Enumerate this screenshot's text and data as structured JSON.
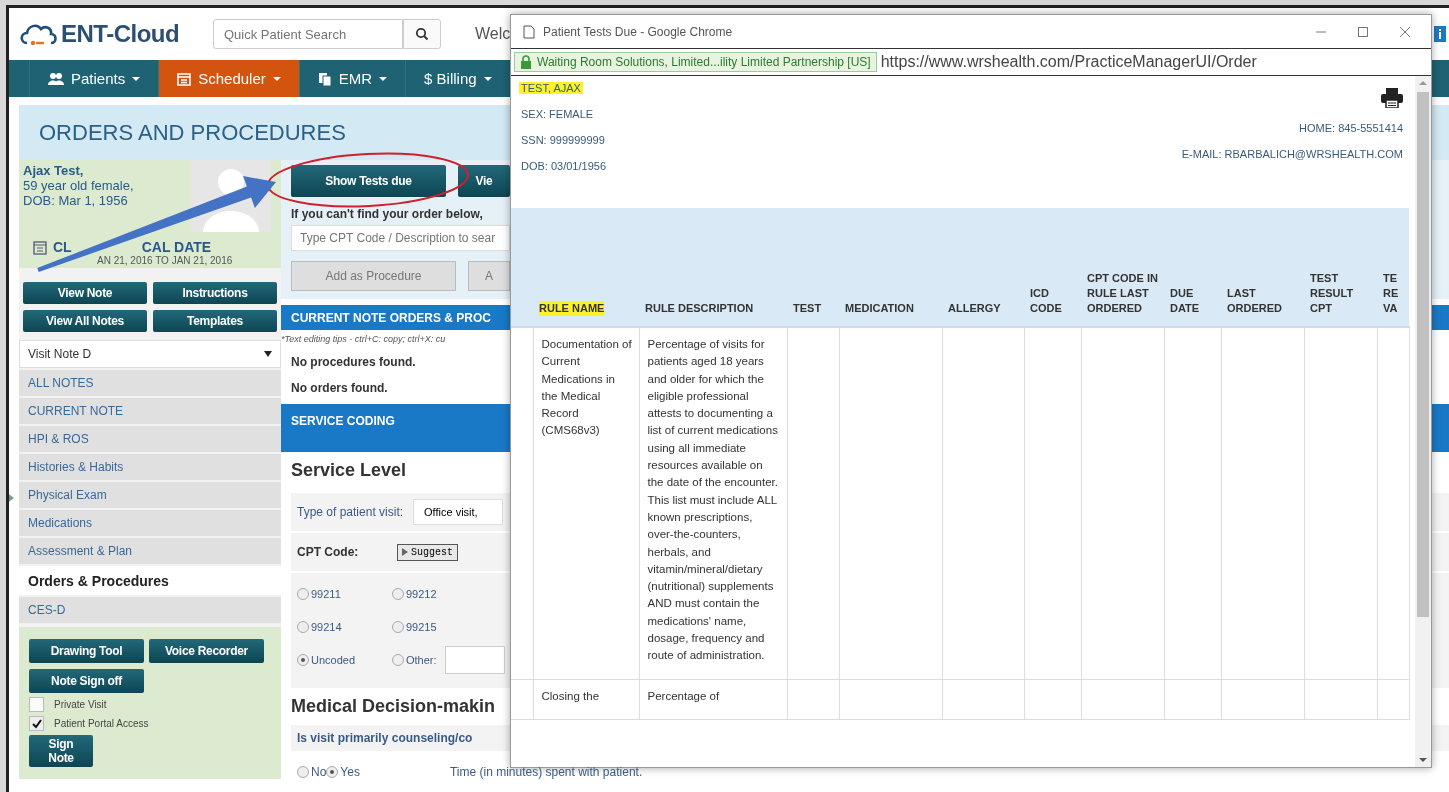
{
  "app": {
    "logo": "ENT-Cloud",
    "search": {
      "placeholder": "Quick Patient Search"
    },
    "welcome": "Welc"
  },
  "nav": [
    {
      "label": "Patients",
      "selected": false
    },
    {
      "label": "Scheduler",
      "selected": true
    },
    {
      "label": "EMR",
      "selected": false
    },
    {
      "label": "$ Billing",
      "selected": false
    }
  ],
  "page_title": "ORDERS AND PROCEDURES",
  "patient": {
    "name": "Ajax Test,",
    "age": "59 year old female,",
    "dob": "DOB: Mar 1, 1956",
    "clinical_date_label": [
      "CL",
      "CAL DATE"
    ],
    "clinical_date": "AN 21, 2016 TO JAN 21, 2016"
  },
  "note_buttons": [
    "View Note",
    "Instructions",
    "View All Notes",
    "Templates"
  ],
  "note_select": {
    "value": "Visit Note D"
  },
  "sections": [
    {
      "label": "ALL NOTES",
      "selected": false
    },
    {
      "label": "CURRENT NOTE",
      "selected": false
    },
    {
      "label": "HPI & ROS",
      "selected": false
    },
    {
      "label": "Histories & Habits",
      "selected": false
    },
    {
      "label": "Physical Exam",
      "selected": false
    },
    {
      "label": "Medications",
      "selected": false
    },
    {
      "label": "Assessment & Plan",
      "selected": false
    },
    {
      "label": "Orders & Procedures",
      "selected": true
    },
    {
      "label": "CES-D",
      "selected": false
    }
  ],
  "tools": {
    "buttons": [
      "Drawing Tool",
      "Voice Recorder",
      "Note Sign off"
    ],
    "checkboxes": [
      {
        "label": "Private Visit",
        "checked": false
      },
      {
        "label": "Patient Portal Access",
        "checked": true
      }
    ],
    "sign_button": "Sign Note"
  },
  "orders": {
    "buttons": [
      {
        "label": "Show Tests due",
        "disabled": false
      },
      {
        "label": "Vie",
        "disabled": false
      }
    ],
    "hint": "If you can't find your order below,",
    "search": {
      "placeholder": "Type CPT Code / Description to sear"
    },
    "add_buttons": [
      {
        "label": "Add as Procedure",
        "disabled": true
      },
      {
        "label": "A",
        "disabled": true
      }
    ],
    "header": "CURRENT NOTE ORDERS & PROC",
    "tips": "*Text editing tips - ctrl+C: copy; ctrl+X: cu",
    "messages": [
      "No procedures found.",
      "No orders found."
    ]
  },
  "service": {
    "header": "SERVICE CODING",
    "title": "Service Level",
    "visit_type_label": "Type of patient visit:",
    "visit_type_value": "Office visit,",
    "cpt_label": "CPT Code:",
    "suggest": "Suggest",
    "codes": [
      {
        "label": "99211",
        "selected": false
      },
      {
        "label": "99212",
        "selected": false
      },
      {
        "label": "99214",
        "selected": false
      },
      {
        "label": "99215",
        "selected": false
      },
      {
        "label": "Uncoded",
        "selected": true
      },
      {
        "label": "Other:",
        "selected": false
      }
    ]
  },
  "decision": {
    "title": "Medical Decision-makin",
    "question": "Is visit primarily counseling/co",
    "answers": [
      {
        "label": "No",
        "selected": false
      },
      {
        "label": "Yes",
        "selected": true
      }
    ],
    "time_label": "Time (in minutes) spent with patient."
  },
  "popup": {
    "title": "Patient Tests Due - Google Chrome",
    "cert": "Waiting Room Solutions, Limited...ility Limited Partnership [US]",
    "url": "https://www.wrshealth.com/PracticeManagerUI/Order",
    "patient": [
      {
        "text": "TEST, AJAX",
        "highlighted": true
      },
      {
        "text": "SEX: FEMALE",
        "highlighted": false
      },
      {
        "text": "SSN: 999999999",
        "highlighted": false
      },
      {
        "text": "DOB: 03/01/1956",
        "highlighted": false
      }
    ],
    "contact": [
      "HOME: 845-5551414",
      "E-MAIL: RBARBALICH@WRSHEALTH.COM"
    ],
    "columns": [
      {
        "label": "RULE NAME",
        "highlighted": true
      },
      {
        "label": "RULE DESCRIPTION",
        "highlighted": false
      },
      {
        "label": "TEST",
        "highlighted": false
      },
      {
        "label": "MEDICATION",
        "highlighted": false
      },
      {
        "label": "ALLERGY",
        "highlighted": false
      },
      {
        "label": "ICD CODE",
        "highlighted": false
      },
      {
        "label": "CPT CODE IN RULE LAST ORDERED",
        "highlighted": false
      },
      {
        "label": "DUE DATE",
        "highlighted": false
      },
      {
        "label": "LAST ORDERED",
        "highlighted": false
      },
      {
        "label": "TEST RESULT CPT",
        "highlighted": false
      },
      {
        "label": "TE RE VA",
        "highlighted": false
      }
    ],
    "rows": [
      {
        "rule_name": "Documentation of Current Medications in the Medical Record (CMS68v3)",
        "rule_description": "Percentage of visits for patients aged 18 years and older for which the eligible professional attests to documenting a list of current medications using all immediate resources available on the date of the encounter. This list must include ALL known prescriptions, over-the-counters, herbals, and vitamin/mineral/dietary (nutritional) supplements AND must contain the medications' name, dosage, frequency and route of administration."
      },
      {
        "rule_name": "Closing the",
        "rule_description": "Percentage of"
      }
    ]
  }
}
